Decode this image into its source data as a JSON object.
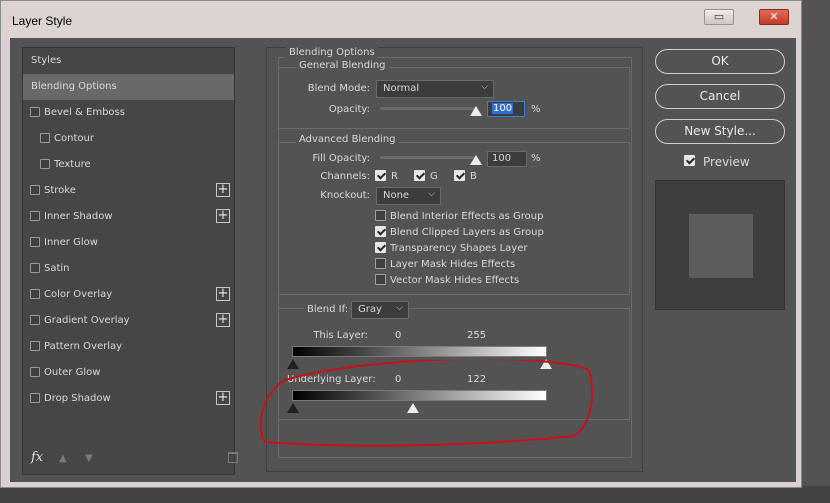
{
  "window": {
    "title": "Layer Style",
    "controls": [
      "minimize-icon",
      "close-icon"
    ]
  },
  "styles_list": {
    "header": "Styles",
    "items": [
      {
        "label": "Blending Options",
        "selected": true,
        "checkbox": false,
        "plus": false
      },
      {
        "label": "Bevel & Emboss",
        "checkbox": true,
        "plus": false
      },
      {
        "label": "Contour",
        "checkbox": true,
        "indent": true,
        "plus": false
      },
      {
        "label": "Texture",
        "checkbox": true,
        "indent": true,
        "plus": false
      },
      {
        "label": "Stroke",
        "checkbox": true,
        "plus": true
      },
      {
        "label": "Inner Shadow",
        "checkbox": true,
        "plus": true
      },
      {
        "label": "Inner Glow",
        "checkbox": true,
        "plus": false
      },
      {
        "label": "Satin",
        "checkbox": true,
        "plus": false
      },
      {
        "label": "Color Overlay",
        "checkbox": true,
        "plus": true
      },
      {
        "label": "Gradient Overlay",
        "checkbox": true,
        "plus": true
      },
      {
        "label": "Pattern Overlay",
        "checkbox": true,
        "plus": false
      },
      {
        "label": "Outer Glow",
        "checkbox": true,
        "plus": false
      },
      {
        "label": "Drop Shadow",
        "checkbox": true,
        "plus": true
      }
    ],
    "footer": {
      "fx_label": "fx",
      "plus_glyph": "+"
    }
  },
  "blending": {
    "section_title": "Blending Options",
    "general": {
      "title": "General Blending",
      "blend_mode_label": "Blend Mode:",
      "blend_mode_value": "Normal",
      "opacity_label": "Opacity:",
      "opacity_value": "100",
      "opacity_level": 1.0,
      "unit": "%"
    },
    "advanced": {
      "title": "Advanced Blending",
      "fill_opacity_label": "Fill Opacity:",
      "fill_opacity_value": "100",
      "fill_opacity_level": 1.0,
      "unit": "%",
      "channels_label": "Channels:",
      "channels": [
        {
          "label": "R",
          "checked": true
        },
        {
          "label": "G",
          "checked": true
        },
        {
          "label": "B",
          "checked": true
        }
      ],
      "knockout_label": "Knockout:",
      "knockout_value": "None",
      "options": [
        {
          "label": "Blend Interior Effects as Group",
          "checked": false
        },
        {
          "label": "Blend Clipped Layers as Group",
          "checked": true
        },
        {
          "label": "Transparency Shapes Layer",
          "checked": true
        },
        {
          "label": "Layer Mask Hides Effects",
          "checked": false
        },
        {
          "label": "Vector Mask Hides Effects",
          "checked": false
        }
      ]
    },
    "blend_if": {
      "label": "Blend If:",
      "value": "Gray",
      "this_layer": {
        "label": "This Layer:",
        "low": "0",
        "high": "255"
      },
      "underlying_layer": {
        "label": "Underlying Layer:",
        "low": "0",
        "high": "122"
      }
    }
  },
  "buttons": {
    "ok": "OK",
    "cancel": "Cancel",
    "new_style": "New Style...",
    "preview_label": "Preview",
    "preview_checked": true
  },
  "colors": {
    "panel": "#535353",
    "list_bg": "#464646",
    "selected": "#696969",
    "focus": "#2f6fd8",
    "annotation": "#c8101f"
  }
}
